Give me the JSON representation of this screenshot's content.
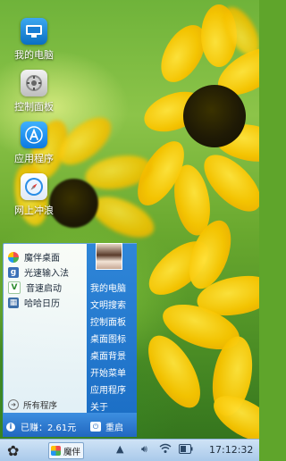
{
  "desktop": {
    "icons": [
      {
        "label": "我的电脑",
        "icon": "computer-icon"
      },
      {
        "label": "控制面板",
        "icon": "control-panel-icon"
      },
      {
        "label": "应用程序",
        "icon": "app-store-icon"
      },
      {
        "label": "网上冲浪",
        "icon": "safari-icon"
      }
    ]
  },
  "start_menu": {
    "programs": [
      {
        "label": "魔伴桌面",
        "icon": "pinwheel-icon"
      },
      {
        "label": "光速输入法",
        "icon": "input-method-icon"
      },
      {
        "label": "音速启动",
        "icon": "v-launcher-icon"
      },
      {
        "label": "哈哈日历",
        "icon": "calendar-icon"
      }
    ],
    "all_programs_label": "所有程序",
    "right_items": [
      {
        "label": "我的电脑"
      },
      {
        "label": "文明搜索"
      },
      {
        "label": "控制面板"
      },
      {
        "label": "桌面图标"
      },
      {
        "label": "桌面背景"
      },
      {
        "label": "开始菜单"
      },
      {
        "label": "应用程序"
      },
      {
        "label": "关于"
      }
    ],
    "earned_label": "已赚：2.61元",
    "restart_label": "重启"
  },
  "taskbar": {
    "task_label": "魔伴",
    "time": "17:12:32"
  },
  "colors": {
    "menu_blue": "#1c6fc6",
    "taskbar": "#a9c9ea",
    "flower_yellow": "#f7c400"
  }
}
